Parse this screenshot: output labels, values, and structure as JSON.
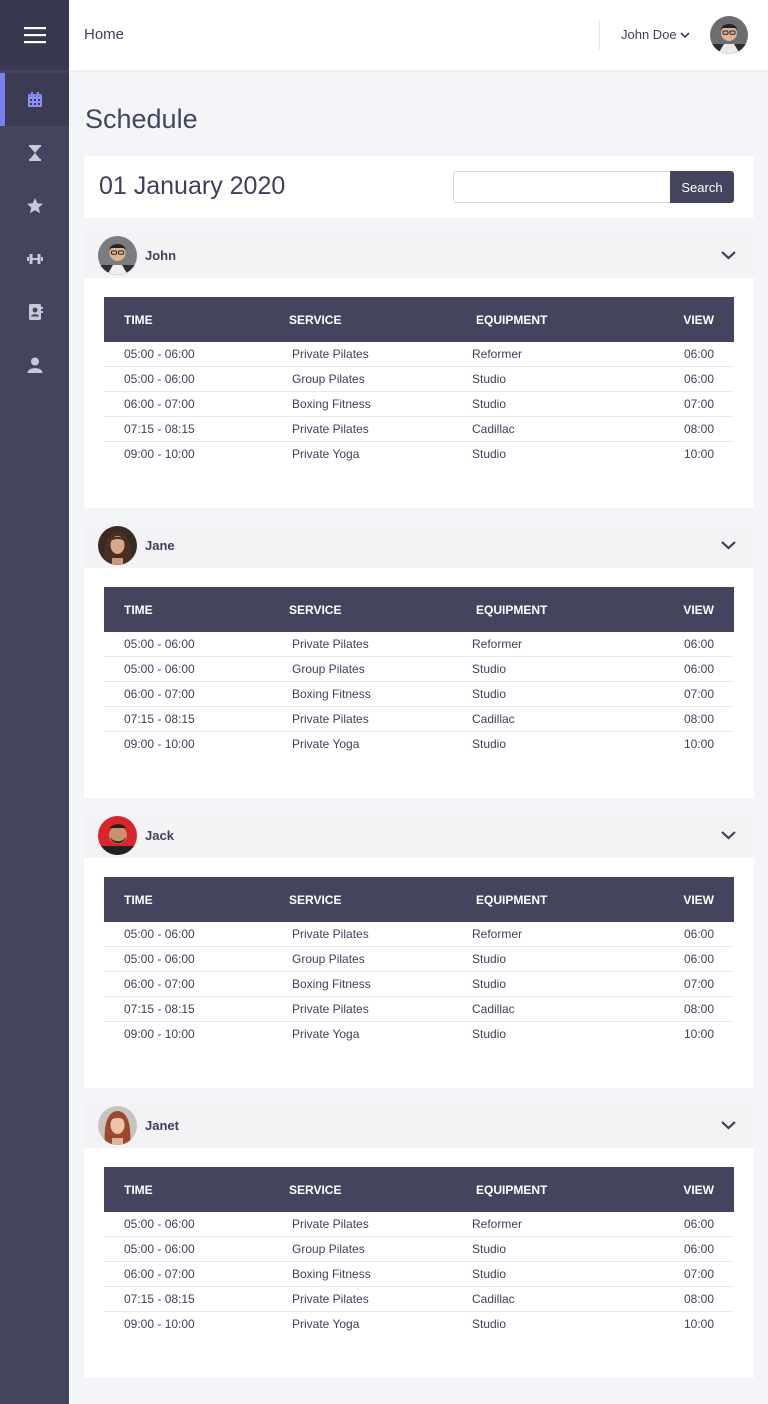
{
  "header": {
    "breadcrumb": "Home",
    "user_name": "John Doe"
  },
  "sidebar": {
    "menu_icon": "hamburger-icon",
    "items": [
      {
        "icon": "calendar-icon",
        "active": true
      },
      {
        "icon": "hourglass-icon",
        "active": false
      },
      {
        "icon": "star-icon",
        "active": false
      },
      {
        "icon": "dumbbell-icon",
        "active": false
      },
      {
        "icon": "contact-book-icon",
        "active": false
      },
      {
        "icon": "user-icon",
        "active": false
      }
    ]
  },
  "page": {
    "title": "Schedule",
    "date": "01 January 2020"
  },
  "search": {
    "button": "Search",
    "placeholder": ""
  },
  "table_headers": {
    "time": "TIME",
    "service": "SERVICE",
    "equipment": "EQUIPMENT",
    "view": "VIEW"
  },
  "trainers": [
    {
      "name": "John",
      "rows": [
        {
          "time": "05:00 - 06:00",
          "service": "Private Pilates",
          "equipment": "Reformer",
          "view": "06:00"
        },
        {
          "time": "05:00 - 06:00",
          "service": "Group Pilates",
          "equipment": "Studio",
          "view": "06:00"
        },
        {
          "time": "06:00 - 07:00",
          "service": "Boxing Fitness",
          "equipment": "Studio",
          "view": "07:00"
        },
        {
          "time": "07:15 - 08:15",
          "service": "Private Pilates",
          "equipment": "Cadillac",
          "view": "08:00"
        },
        {
          "time": "09:00 - 10:00",
          "service": "Private Yoga",
          "equipment": "Studio",
          "view": "10:00"
        }
      ]
    },
    {
      "name": "Jane",
      "rows": [
        {
          "time": "05:00 - 06:00",
          "service": "Private Pilates",
          "equipment": "Reformer",
          "view": "06:00"
        },
        {
          "time": "05:00 - 06:00",
          "service": "Group Pilates",
          "equipment": "Studio",
          "view": "06:00"
        },
        {
          "time": "06:00 - 07:00",
          "service": "Boxing Fitness",
          "equipment": "Studio",
          "view": "07:00"
        },
        {
          "time": "07:15 - 08:15",
          "service": "Private Pilates",
          "equipment": "Cadillac",
          "view": "08:00"
        },
        {
          "time": "09:00 - 10:00",
          "service": "Private Yoga",
          "equipment": "Studio",
          "view": "10:00"
        }
      ]
    },
    {
      "name": "Jack",
      "rows": [
        {
          "time": "05:00 - 06:00",
          "service": "Private Pilates",
          "equipment": "Reformer",
          "view": "06:00"
        },
        {
          "time": "05:00 - 06:00",
          "service": "Group Pilates",
          "equipment": "Studio",
          "view": "06:00"
        },
        {
          "time": "06:00 - 07:00",
          "service": "Boxing Fitness",
          "equipment": "Studio",
          "view": "07:00"
        },
        {
          "time": "07:15 - 08:15",
          "service": "Private Pilates",
          "equipment": "Cadillac",
          "view": "08:00"
        },
        {
          "time": "09:00 - 10:00",
          "service": "Private Yoga",
          "equipment": "Studio",
          "view": "10:00"
        }
      ]
    },
    {
      "name": "Janet",
      "rows": [
        {
          "time": "05:00 - 06:00",
          "service": "Private Pilates",
          "equipment": "Reformer",
          "view": "06:00"
        },
        {
          "time": "05:00 - 06:00",
          "service": "Group Pilates",
          "equipment": "Studio",
          "view": "06:00"
        },
        {
          "time": "06:00 - 07:00",
          "service": "Boxing Fitness",
          "equipment": "Studio",
          "view": "07:00"
        },
        {
          "time": "07:15 - 08:15",
          "service": "Private Pilates",
          "equipment": "Cadillac",
          "view": "08:00"
        },
        {
          "time": "09:00 - 10:00",
          "service": "Private Yoga",
          "equipment": "Studio",
          "view": "10:00"
        }
      ]
    }
  ],
  "colors": {
    "sidebar": "#44445e",
    "accent": "#7a7ff0",
    "table_header": "#44445e"
  }
}
